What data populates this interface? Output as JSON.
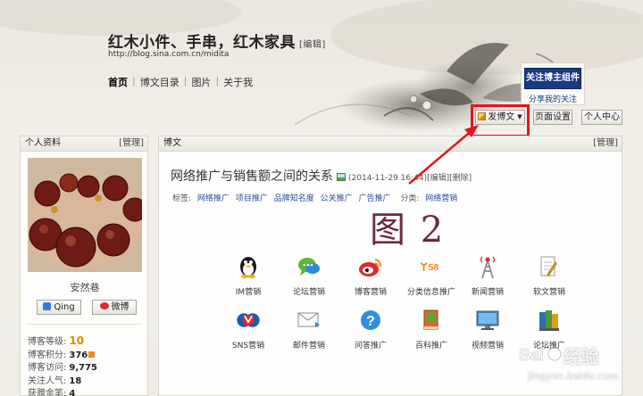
{
  "header": {
    "title": "红木小件、手串，红木家具",
    "edit_label": "[编辑]",
    "url": "http://blog.sina.com.cn/midita",
    "nav": [
      "首页",
      "博文目录",
      "图片",
      "关于我"
    ],
    "follow_label": "关注博主组件",
    "share_label": "分享我的关注",
    "post_button": "发博文",
    "page_settings": "页面设置",
    "personal_center": "个人中心"
  },
  "profile": {
    "heading": "个人资料",
    "manage": "[管理]",
    "username": "安然巷",
    "qq_label": "Qing",
    "weibo_label": "微博",
    "stats": [
      {
        "label": "博客等级:",
        "value": "10"
      },
      {
        "label": "博客积分:",
        "value": "376"
      },
      {
        "label": "博客访问:",
        "value": "9,775"
      },
      {
        "label": "关注人气:",
        "value": "18"
      },
      {
        "label": "获赠金笔:",
        "value": "4"
      }
    ]
  },
  "main": {
    "heading": "博文",
    "manage": "[管理]",
    "post_title": "网络推广与销售额之间的关系",
    "post_time": "(2014-11-29 16:44)",
    "post_edit": "[编辑]",
    "post_delete": "[删除]",
    "tags_label": "标签:",
    "tags": [
      "网络推广",
      "项目推广",
      "品牌知名度",
      "公关推广",
      "广告推广"
    ],
    "category_label": "分类:",
    "category": "网络营销",
    "figure_label": "图 2",
    "grid_row1": [
      "IM营销",
      "论坛营销",
      "博客营销",
      "分类信息推广",
      "新闻营销",
      "软文营销"
    ],
    "grid_row2": [
      "SNS营销",
      "邮件营销",
      "问答推广",
      "百科推广",
      "视频营销",
      "论坛推广"
    ]
  },
  "watermark": {
    "brand": "经验",
    "url": "jingyan.baidu.com"
  },
  "colors": {
    "highlight": "#e6141b",
    "link": "#2a4f96",
    "follow_bg": "#173a85",
    "figure_label": "#6b2a45"
  }
}
